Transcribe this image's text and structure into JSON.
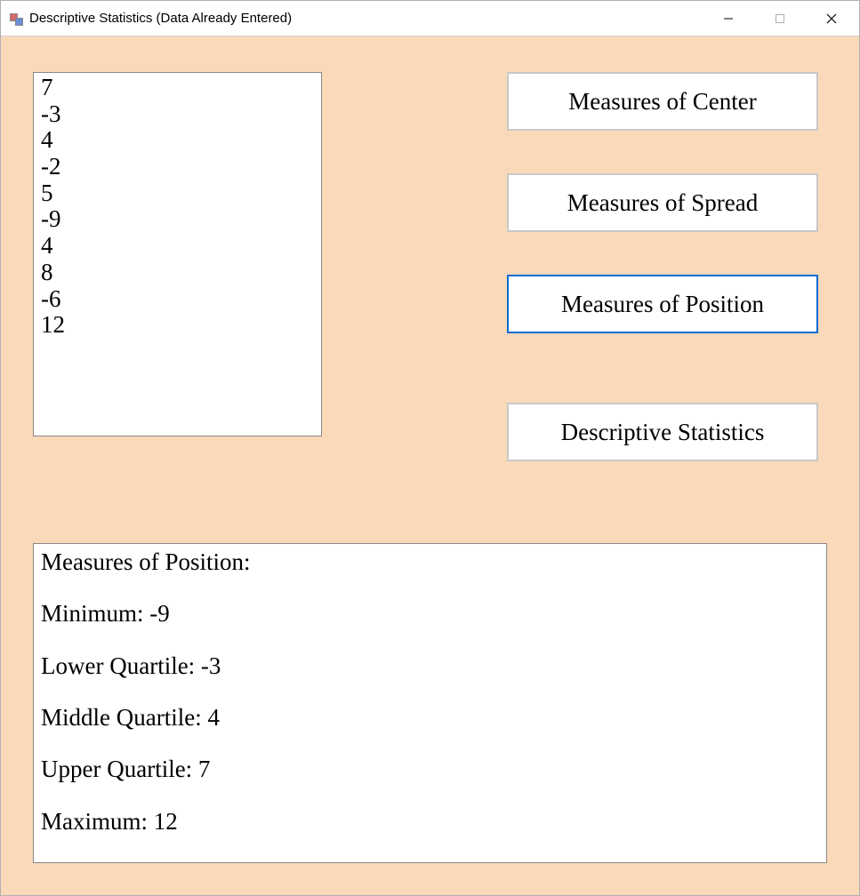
{
  "window": {
    "title": "Descriptive Statistics (Data Already Entered)"
  },
  "data_list": {
    "values": [
      "7",
      "-3",
      "4",
      "-2",
      "5",
      "-9",
      "4",
      "8",
      "-6",
      "12"
    ]
  },
  "buttons": {
    "center": {
      "label": "Measures of Center",
      "selected": false
    },
    "spread": {
      "label": "Measures of Spread",
      "selected": false
    },
    "position": {
      "label": "Measures of Position",
      "selected": true
    },
    "descstat": {
      "label": "Descriptive Statistics",
      "selected": false
    }
  },
  "output": {
    "heading": "Measures of Position:",
    "lines": [
      "Minimum: -9",
      "Lower Quartile: -3",
      "Middle Quartile: 4",
      "Upper Quartile: 7",
      "Maximum: 12"
    ]
  }
}
